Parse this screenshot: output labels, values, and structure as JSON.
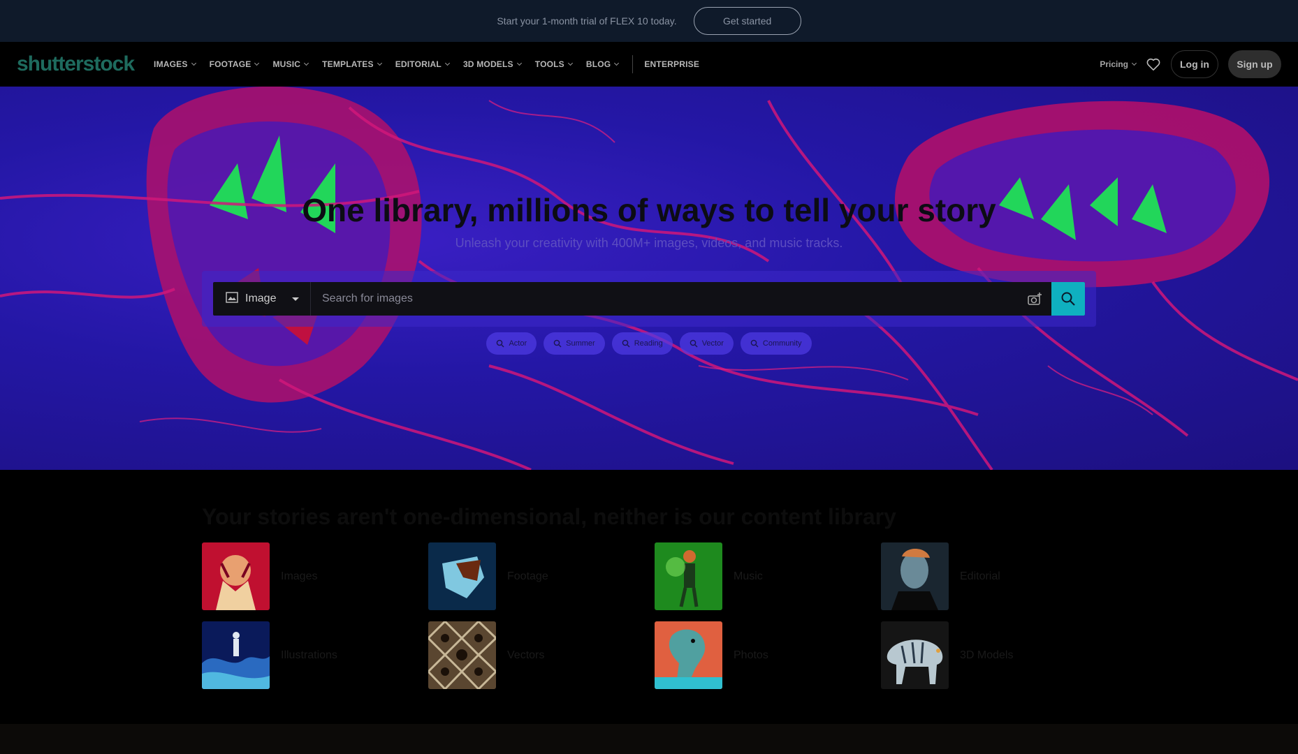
{
  "promo": {
    "text": "Start your 1-month trial of FLEX 10 today.",
    "button": "Get started"
  },
  "nav": {
    "logo": "shutterstock",
    "items": [
      "IMAGES",
      "FOOTAGE",
      "MUSIC",
      "TEMPLATES",
      "EDITORIAL",
      "3D MODELS",
      "TOOLS",
      "BLOG"
    ],
    "enterprise": "ENTERPRISE",
    "pricing": "Pricing",
    "login": "Log in",
    "signup": "Sign up"
  },
  "hero": {
    "title": "One library, millions of ways to tell your story",
    "subtitle": "Unleash your creativity with 400M+ images, videos, and music tracks.",
    "search": {
      "type": "Image",
      "placeholder": "Search for images"
    },
    "chips": [
      "Actor",
      "Summer",
      "Reading",
      "Vector",
      "Community"
    ]
  },
  "content": {
    "title": "Your stories aren't one-dimensional, neither is our content library",
    "categories": [
      "Images",
      "Footage",
      "Music",
      "Editorial",
      "Illustrations",
      "Vectors",
      "Photos",
      "3D Models"
    ]
  },
  "colors": {
    "accent": "#0fb0c0",
    "hero": "#2417a6",
    "magenta": "#d0177a",
    "green": "#22d65a"
  }
}
